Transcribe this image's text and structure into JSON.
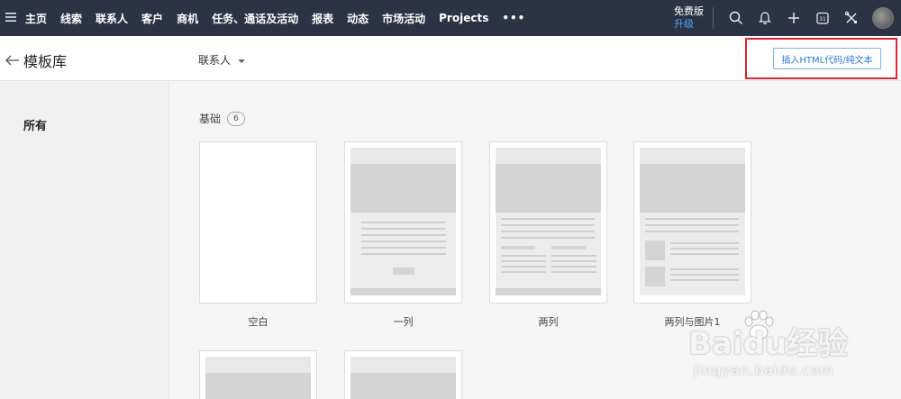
{
  "nav": {
    "menu_icon": "hamburger-icon",
    "items": [
      "主页",
      "线索",
      "联系人",
      "客户",
      "商机",
      "任务、通话及活动",
      "报表",
      "动态",
      "市场活动",
      "Projects"
    ],
    "more": "•••",
    "edition_name": "免费版",
    "edition_upgrade": "升级",
    "upgrade_color": "#4ea4ff",
    "icons": [
      "search-icon",
      "bell-icon",
      "plus-icon",
      "calendar-icon",
      "tools-icon"
    ]
  },
  "subheader": {
    "back_icon": "arrow-left-icon",
    "title": "模板库",
    "module": "联系人",
    "insert_button": "插入HTML代码/纯文本",
    "highlight_color": "#e0232c"
  },
  "sidebar": {
    "all_label": "所有"
  },
  "main": {
    "section_title": "基础",
    "section_count": "6",
    "templates": [
      {
        "name": "空白"
      },
      {
        "name": "一列"
      },
      {
        "name": "两列"
      },
      {
        "name": "两列与图片1"
      }
    ]
  },
  "watermark": {
    "brand": "Baidu经验",
    "url": "jingyan.baidu.com"
  }
}
